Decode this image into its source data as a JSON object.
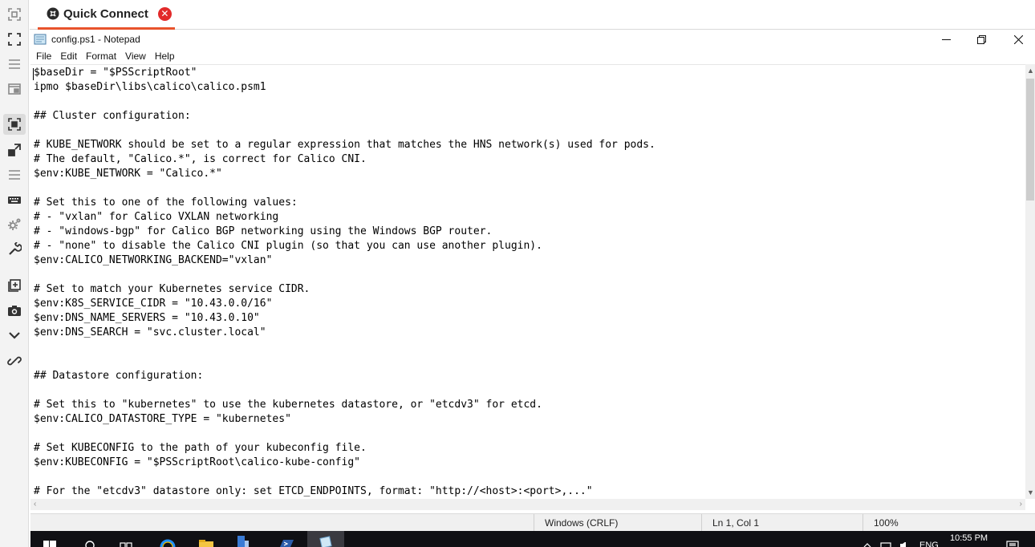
{
  "tabs": [
    {
      "label": "Quick Connect",
      "active": true
    }
  ],
  "window": {
    "title": "config.ps1 - Notepad",
    "controls": [
      "minimize",
      "restore",
      "close"
    ]
  },
  "menu": [
    "File",
    "Edit",
    "Format",
    "View",
    "Help"
  ],
  "editor": {
    "content": "$baseDir = \"$PSScriptRoot\"\nipmo $baseDir\\libs\\calico\\calico.psm1\n\n## Cluster configuration:\n\n# KUBE_NETWORK should be set to a regular expression that matches the HNS network(s) used for pods.\n# The default, \"Calico.*\", is correct for Calico CNI.\n$env:KUBE_NETWORK = \"Calico.*\"\n\n# Set this to one of the following values:\n# - \"vxlan\" for Calico VXLAN networking\n# - \"windows-bgp\" for Calico BGP networking using the Windows BGP router.\n# - \"none\" to disable the Calico CNI plugin (so that you can use another plugin).\n$env:CALICO_NETWORKING_BACKEND=\"vxlan\"\n\n# Set to match your Kubernetes service CIDR.\n$env:K8S_SERVICE_CIDR = \"10.43.0.0/16\"\n$env:DNS_NAME_SERVERS = \"10.43.0.10\"\n$env:DNS_SEARCH = \"svc.cluster.local\"\n\n\n## Datastore configuration:\n\n# Set this to \"kubernetes\" to use the kubernetes datastore, or \"etcdv3\" for etcd.\n$env:CALICO_DATASTORE_TYPE = \"kubernetes\"\n\n# Set KUBECONFIG to the path of your kubeconfig file.\n$env:KUBECONFIG = \"$PSScriptRoot\\calico-kube-config\"\n\n# For the \"etcdv3\" datastore only: set ETCD_ENDPOINTS, format: \"http://<host>:<port>,...\""
  },
  "status": {
    "line_ending": "Windows (CRLF)",
    "position": "Ln 1, Col 1",
    "zoom": "100%"
  },
  "left_toolbar": [
    "screenshot-icon",
    "fullscreen-icon",
    "menu-icon",
    "window-icon",
    "remote-control-icon",
    "scale-icon",
    "list-icon",
    "keyboard-icon",
    "settings-icon",
    "tools-icon",
    "new-session-icon",
    "camera-icon",
    "chevron-down-icon",
    "link-icon"
  ],
  "taskbar": {
    "time": "10:55 PM",
    "language": "ENG",
    "apps": [
      "start-icon",
      "search-icon",
      "task-view-icon",
      "edge-icon",
      "file-explorer-icon",
      "server-manager-icon",
      "powershell-icon",
      "notepad-icon"
    ]
  },
  "colors": {
    "tab_accent": "#e8532c",
    "tab_close": "#e22a2a",
    "taskbar": "#101014"
  }
}
